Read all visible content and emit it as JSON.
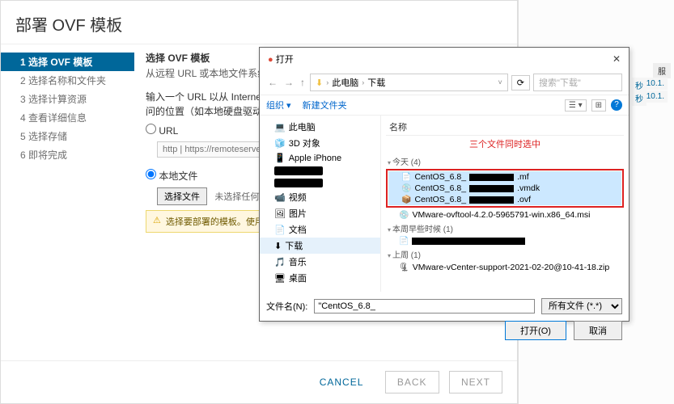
{
  "wizard": {
    "title": "部署 OVF 模板",
    "steps": [
      {
        "label": "1 选择 OVF 模板",
        "active": true
      },
      {
        "label": "2 选择名称和文件夹"
      },
      {
        "label": "3 选择计算资源"
      },
      {
        "label": "4 查看详细信息"
      },
      {
        "label": "5 选择存储"
      },
      {
        "label": "6 即将完成"
      }
    ],
    "section_title": "选择 OVF 模板",
    "section_desc": "从远程 URL 或本地文件系统选择一个 OVF 模板。",
    "para1": "输入一个 URL 以从 Internet 下载和安装 OVF 软件包，或者浏览到可从您的计算机访问的位置（如本地硬盘驱动器、网络共享或 CD/DVD 驱动器）。",
    "url_label": "URL",
    "url_placeholder": "http | https://remoteserver-address/filetodeploy.ovf | .ova",
    "local_label": "本地文件",
    "choose_btn": "选择文件",
    "no_file": "未选择任何文件",
    "alert_text": "选择要部署的模板。使用多选可部署多个虚拟机。",
    "footer": {
      "cancel": "CANCEL",
      "back": "BACK",
      "next": "NEXT"
    }
  },
  "bg": {
    "col_hdr": "服",
    "cell1_a": "秒",
    "cell1_b": "10.1.",
    "cell2_a": "秒",
    "cell2_b": "10.1."
  },
  "dialog": {
    "title": "打开",
    "path": {
      "root": "此电脑",
      "folder": "下载"
    },
    "search_placeholder": "搜索\"下载\"",
    "toolbar": {
      "organize": "组织",
      "newfolder": "新建文件夹"
    },
    "tree": [
      {
        "icon": "💻",
        "label": "此电脑"
      },
      {
        "icon": "🧊",
        "label": "3D 对象"
      },
      {
        "icon": "📱",
        "label": "Apple iPhone"
      },
      {
        "icon": "",
        "label": "",
        "redact": true
      },
      {
        "icon": "",
        "label": "",
        "redact": true
      },
      {
        "icon": "📹",
        "label": "视频"
      },
      {
        "icon": "🖼",
        "label": "图片"
      },
      {
        "icon": "📄",
        "label": "文档"
      },
      {
        "icon": "⬇",
        "label": "下载",
        "sel": true
      },
      {
        "icon": "🎵",
        "label": "音乐"
      },
      {
        "icon": "🖥",
        "label": "桌面"
      }
    ],
    "files_header": "名称",
    "note": "三个文件同时选中",
    "groups": {
      "today": "今天 (4)",
      "thisweek": "本周早些时候 (1)",
      "lastweek": "上周 (1)"
    },
    "selected": [
      {
        "icon": "📄",
        "name": "CentOS_6.8_",
        "ext": ".mf"
      },
      {
        "icon": "💿",
        "name": "CentOS_6.8_",
        "ext": ".vmdk"
      },
      {
        "icon": "📦",
        "name": "CentOS_6.8_",
        "ext": ".ovf"
      }
    ],
    "other": [
      {
        "icon": "💿",
        "name": "VMware-ovftool-4.2.0-5965791-win.x86_64.msi"
      }
    ],
    "lastweek_files": [
      {
        "icon": "🗜",
        "name": "VMware-vCenter-support-2021-02-20@10-41-18.zip"
      }
    ],
    "filename_label": "文件名(N):",
    "filename_value": "\"CentOS_6.8_",
    "filter": "所有文件 (*.*)",
    "open_btn": "打开(O)",
    "cancel_btn": "取消"
  }
}
